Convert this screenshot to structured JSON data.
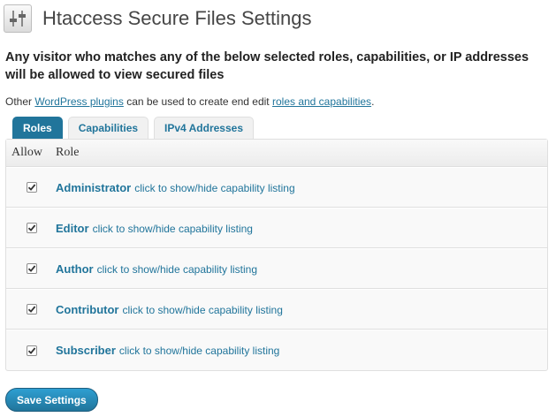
{
  "header": {
    "title": "Htaccess Secure Files Settings",
    "icon": "settings-sliders-icon"
  },
  "notice": "Any visitor who matches any of the below selected roles, capabilities, or IP addresses will be allowed to view secured files",
  "intro": {
    "prefix": "Other ",
    "link1": "WordPress plugins",
    "middle": " can be used to create end edit ",
    "link2": "roles and capabilities",
    "suffix": "."
  },
  "tabs": [
    {
      "label": "Roles",
      "active": true
    },
    {
      "label": "Capabilities",
      "active": false
    },
    {
      "label": "IPv4 Addresses",
      "active": false
    }
  ],
  "table": {
    "headers": {
      "allow": "Allow",
      "role": "Role"
    },
    "rows": [
      {
        "role": "Administrator",
        "toggle": "click to show/hide capability listing",
        "checked": true
      },
      {
        "role": "Editor",
        "toggle": "click to show/hide capability listing",
        "checked": true
      },
      {
        "role": "Author",
        "toggle": "click to show/hide capability listing",
        "checked": true
      },
      {
        "role": "Contributor",
        "toggle": "click to show/hide capability listing",
        "checked": true
      },
      {
        "role": "Subscriber",
        "toggle": "click to show/hide capability listing",
        "checked": true
      }
    ]
  },
  "save_button": "Save Settings",
  "colors": {
    "link": "#21759b",
    "tab_active": "#21759b",
    "button": "#21759b"
  }
}
